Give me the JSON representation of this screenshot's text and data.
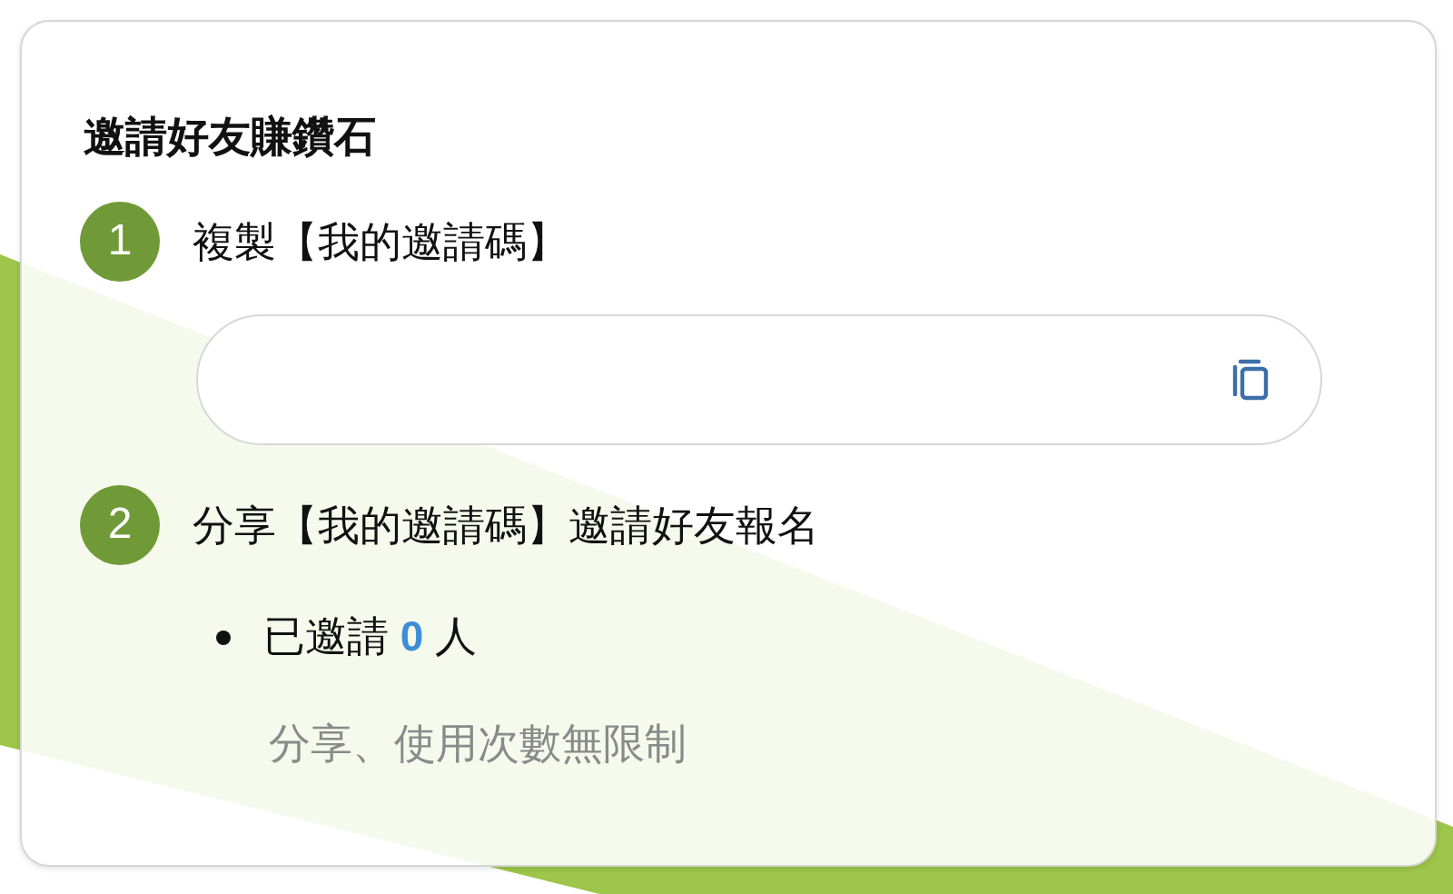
{
  "card": {
    "title": "邀請好友賺鑽石",
    "steps": [
      {
        "kind": "copy_code",
        "number": "1",
        "label": "複製【我的邀請碼】"
      },
      {
        "kind": "share",
        "number": "2",
        "label": "分享【我的邀請碼】邀請好友報名",
        "invited_prefix": "已邀請",
        "invited_count": "0",
        "invited_suffix": "人",
        "note": "分享、使用次數無限制"
      }
    ]
  }
}
